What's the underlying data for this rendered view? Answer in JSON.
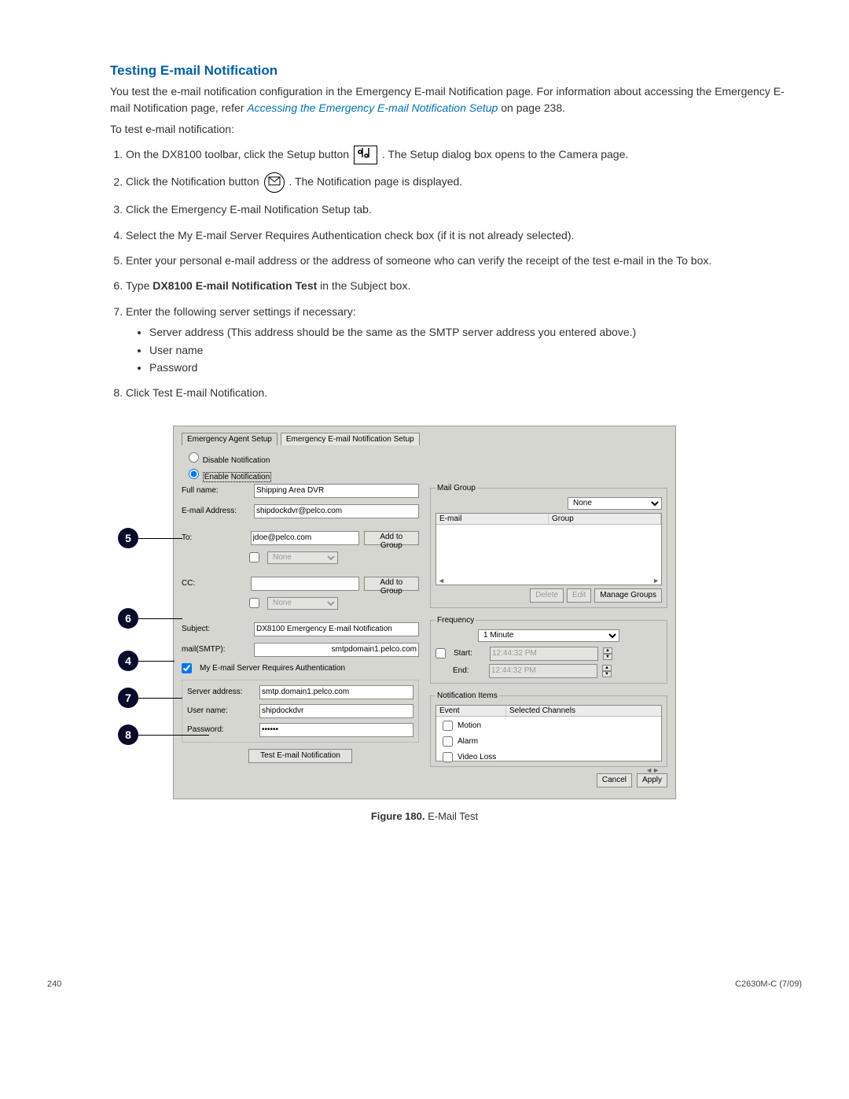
{
  "section_title": "Testing E-mail Notification",
  "intro_before_link": "You test the e-mail notification configuration in the Emergency E-mail Notification page. For information about accessing the Emergency E-mail Notification page, refer ",
  "intro_link": "Accessing the Emergency E-mail Notification Setup",
  "intro_after_link": " on page 238.",
  "to_test": "To test e-mail notification:",
  "steps": {
    "s1a": "On the DX8100 toolbar, click the Setup button ",
    "s1b": ". The Setup dialog box opens to the Camera page.",
    "s2a": "Click the Notification button ",
    "s2b": ". The Notification page is displayed.",
    "s3": "Click the Emergency E-mail Notification Setup tab.",
    "s4": "Select the My E-mail Server Requires Authentication check box (if it is not already selected).",
    "s5": "Enter your personal e-mail address or the address of someone who can verify the receipt of the test e-mail in the To box.",
    "s6a": "Type ",
    "s6bold": "DX8100 E-mail Notification Test",
    "s6b": " in the Subject box.",
    "s7": "Enter the following server settings if necessary:",
    "s7_items": {
      "a": "Server address (This address should be the same as the SMTP server address you entered above.)",
      "b": "User name",
      "c": "Password"
    },
    "s8": "Click Test E-mail Notification."
  },
  "callouts": {
    "c5": "5",
    "c6": "6",
    "c4": "4",
    "c7": "7",
    "c8": "8"
  },
  "dialog": {
    "tab1": "Emergency Agent Setup",
    "tab2": "Emergency E-mail Notification Setup",
    "radio_disable": "Disable Notification",
    "radio_enable": "Enable Notification",
    "lbl_fullname": "Full name:",
    "val_fullname": "Shipping Area DVR",
    "lbl_email": "E-mail Address:",
    "val_email": "shipdockdvr@pelco.com",
    "lbl_to": "To:",
    "val_to": "jdoe@pelco.com",
    "btn_addgroup": "Add to Group",
    "sel_none": "None",
    "lbl_cc": "CC:",
    "lbl_subject": "Subject:",
    "val_subject": "DX8100 Emergency E-mail Notification",
    "lbl_smtp": "mail(SMTP):",
    "val_smtp": "smtpdomain1.pelco.com",
    "chk_auth": "My E-mail Server Requires Authentication",
    "lbl_server": "Server address:",
    "val_server": "smtp.domain1.pelco.com",
    "lbl_user": "User name:",
    "val_user": "shipdockdvr",
    "lbl_pass": "Password:",
    "val_pass": "••••••",
    "btn_test": "Test E-mail Notification",
    "grp_mail": "Mail Group",
    "hdr_email": "E-mail",
    "hdr_group": "Group",
    "btn_delete": "Delete",
    "btn_edit": "Edit",
    "btn_manage": "Manage Groups",
    "grp_freq": "Frequency",
    "freq_val": "1 Minute",
    "lbl_start": "Start:",
    "lbl_end": "End:",
    "time_val": "12:44:32 PM",
    "grp_items": "Notification Items",
    "hdr_event": "Event",
    "hdr_selchan": "Selected Channels",
    "itm_motion": "Motion",
    "itm_alarm": "Alarm",
    "itm_video": "Video Loss",
    "btn_cancel": "Cancel",
    "btn_apply": "Apply"
  },
  "caption_bold": "Figure 180.",
  "caption_rest": "  E-Mail Test",
  "footer_left": "240",
  "footer_right": "C2630M-C (7/09)"
}
